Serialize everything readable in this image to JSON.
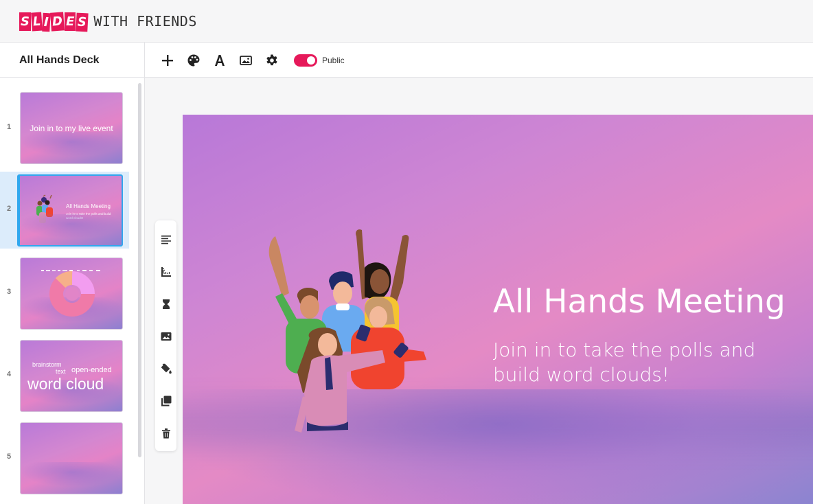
{
  "brand": {
    "logo_letters": [
      "S",
      "L",
      "I",
      "D",
      "E",
      "S"
    ],
    "logo_rest": "WITH FRIENDS",
    "accent_color": "#e6195a"
  },
  "deck": {
    "title": "All Hands Deck"
  },
  "toolbar": {
    "items": [
      "add-icon",
      "palette-icon",
      "text-icon",
      "image-icon",
      "settings-icon"
    ],
    "visibility_label": "Public",
    "visibility_on": true
  },
  "sidebar": {
    "selected_index": 2,
    "slides": [
      {
        "number": "1",
        "text": "Join in to my live event"
      },
      {
        "number": "2",
        "title": "All Hands Meeting",
        "subtitle": "Join in to take the polls and build word clouds!"
      },
      {
        "number": "3",
        "type": "donut-chart"
      },
      {
        "number": "4",
        "words": [
          "brainstorm",
          "text",
          "open-ended",
          "word cloud"
        ]
      },
      {
        "number": "5"
      }
    ]
  },
  "slide_tools": [
    "align-left-icon",
    "ruler-icon",
    "hourglass-icon",
    "image-icon",
    "paint-bucket-icon",
    "duplicate-icon",
    "trash-icon"
  ],
  "current_slide": {
    "title": "All Hands Meeting",
    "subtitle": "Join in to take the polls and build word clouds!"
  }
}
